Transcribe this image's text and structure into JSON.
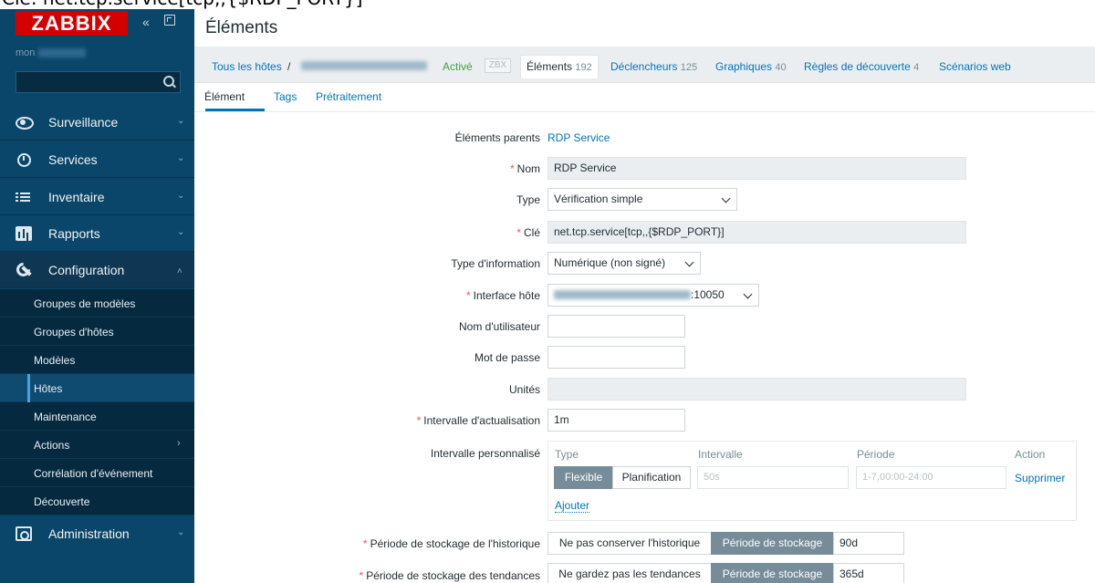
{
  "caption": "Clé: net.tcp.service[tcp,,{$RDP_PORT}]",
  "sidebar": {
    "logo": "ZABBIX",
    "server_name": "mon",
    "menu": [
      {
        "label": "Surveillance",
        "icon": "eye-icon"
      },
      {
        "label": "Services",
        "icon": "clock-icon"
      },
      {
        "label": "Inventaire",
        "icon": "list-icon"
      },
      {
        "label": "Rapports",
        "icon": "chart-icon"
      },
      {
        "label": "Configuration",
        "icon": "wrench-icon"
      },
      {
        "label": "Administration",
        "icon": "admin-icon"
      }
    ],
    "submenu": [
      {
        "label": "Groupes de modèles"
      },
      {
        "label": "Groupes d'hôtes"
      },
      {
        "label": "Modèles"
      },
      {
        "label": "Hôtes"
      },
      {
        "label": "Maintenance"
      },
      {
        "label": "Actions"
      },
      {
        "label": "Corrélation d'événement"
      },
      {
        "label": "Découverte"
      }
    ]
  },
  "header": {
    "title": "Éléments"
  },
  "nav": {
    "all_hosts": "Tous les hôtes",
    "separator": "/",
    "status": "Activé",
    "zbx": "ZBX",
    "items": {
      "label": "Éléments",
      "count": "192"
    },
    "triggers": {
      "label": "Déclencheurs",
      "count": "125"
    },
    "graphs": {
      "label": "Graphiques",
      "count": "40"
    },
    "discovery": {
      "label": "Règles de découverte",
      "count": "4"
    },
    "web": {
      "label": "Scénarios web"
    }
  },
  "tabs": [
    "Élément",
    "Tags",
    "Prétraitement"
  ],
  "form": {
    "parent_label": "Éléments parents",
    "parent_link": "RDP Service",
    "name_label": "Nom",
    "name_value": "RDP Service",
    "type_label": "Type",
    "type_value": "Vérification simple",
    "key_label": "Clé",
    "key_value": "net.tcp.service[tcp,,{$RDP_PORT}]",
    "info_type_label": "Type d'information",
    "info_type_value": "Numérique (non signé)",
    "interface_label": "Interface hôte",
    "interface_value": ":10050",
    "user_label": "Nom d'utilisateur",
    "password_label": "Mot de passe",
    "units_label": "Unités",
    "interval_label": "Intervalle d'actualisation",
    "interval_value": "1m",
    "custom_label": "Intervalle personnalisé",
    "custom": {
      "col_type": "Type",
      "col_interval": "Intervalle",
      "col_period": "Période",
      "col_action": "Action",
      "flexible": "Flexible",
      "scheduling": "Planification",
      "interval_placeholder": "50s",
      "period_placeholder": "1-7,00:00-24:00",
      "remove": "Supprimer",
      "add": "Ajouter"
    },
    "history_label": "Période de stockage de l'historique",
    "history_off": "Ne pas conserver l'historique",
    "history_on": "Période de stockage",
    "history_value": "90d",
    "trends_label": "Période de stockage des tendances",
    "trends_off": "Ne gardez pas les tendances",
    "trends_on": "Période de stockage",
    "trends_value": "365d"
  }
}
